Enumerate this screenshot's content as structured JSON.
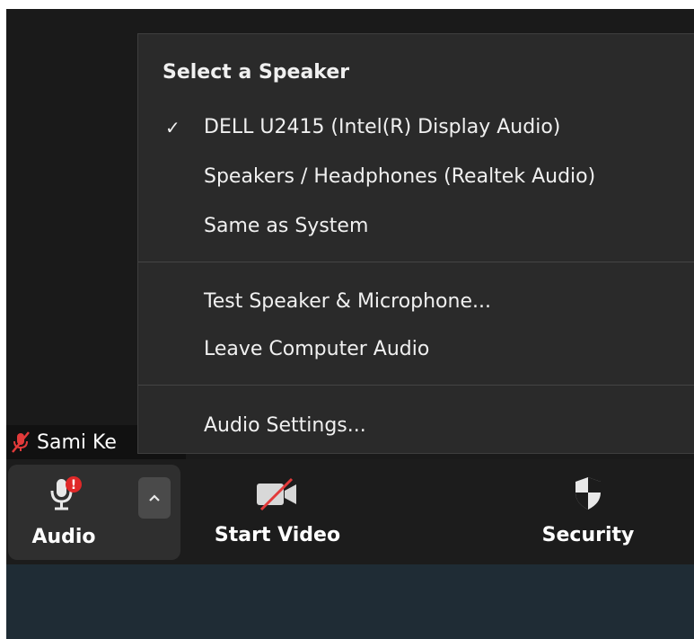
{
  "menu": {
    "title": "Select a Speaker",
    "speakers": [
      {
        "label": "DELL U2415 (Intel(R) Display Audio)",
        "checked": true
      },
      {
        "label": "Speakers / Headphones (Realtek Audio)",
        "checked": false
      },
      {
        "label": "Same as System",
        "checked": false
      }
    ],
    "check_glyph": "✓",
    "actions": [
      {
        "label": "Test Speaker & Microphone..."
      },
      {
        "label": "Leave Computer Audio"
      }
    ],
    "settings": {
      "label": "Audio Settings..."
    }
  },
  "participant": {
    "name": "Sami Ke",
    "icon": "muted-mic-icon"
  },
  "toolbar": {
    "audio_label": "Audio",
    "video_label": "Start Video",
    "security_label": "Security",
    "alert_glyph": "!",
    "icons": [
      "mic-alert-icon",
      "caret-up-icon",
      "video-off-icon",
      "shield-icon"
    ]
  },
  "colors": {
    "background": "#1a1a1a",
    "menu_bg": "#2a2a2a",
    "toolbar_bg": "#1c1c1c",
    "alert_red": "#e02828",
    "slash_red": "#e23a3a",
    "bottom_strip": "#1f2c35"
  }
}
